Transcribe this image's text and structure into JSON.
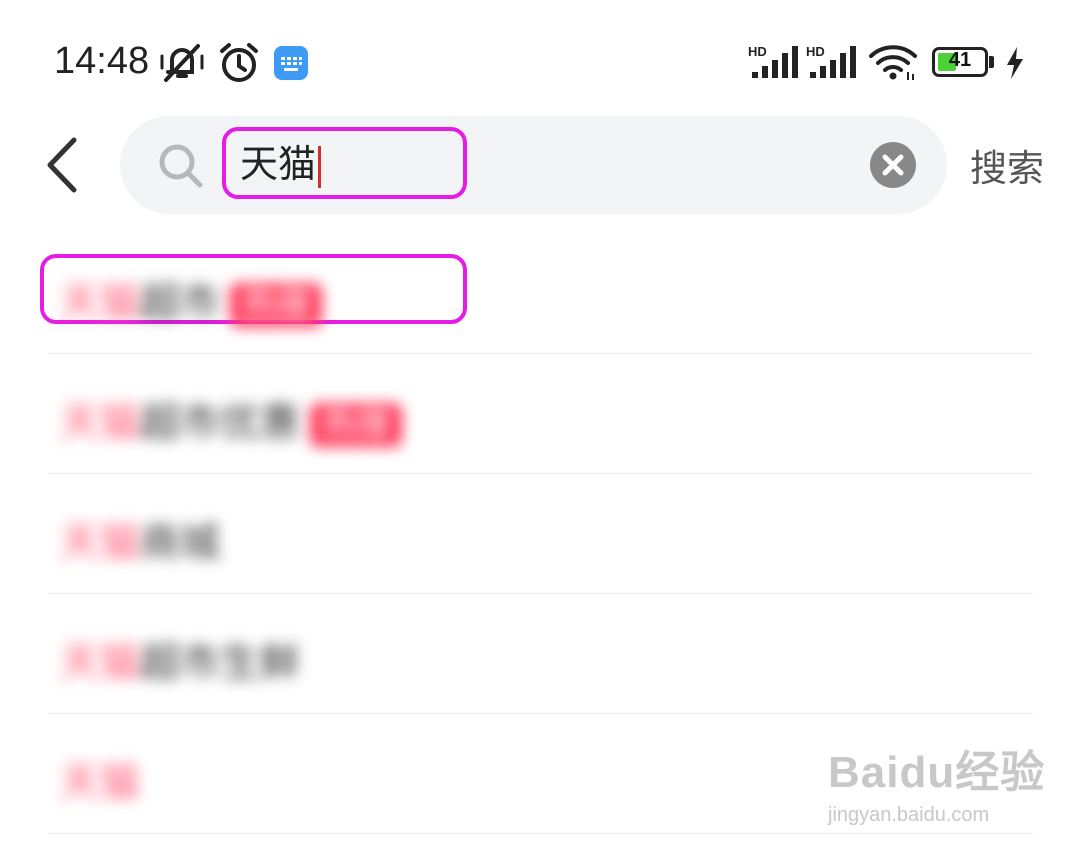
{
  "status_bar": {
    "time": "14:48",
    "icons": [
      "mute-vibrate-icon",
      "alarm-icon",
      "keyboard-app-icon",
      "signal-hd-1-icon",
      "signal-hd-2-icon",
      "wifi-icon",
      "charging-icon"
    ],
    "signal_labels": [
      "HD",
      "HD"
    ],
    "battery_level": "41",
    "battery_fraction": 0.41
  },
  "search": {
    "query": "天猫",
    "submit_label": "搜索"
  },
  "suggestions": [
    {
      "keyword": "天猫",
      "rest": "超市",
      "tag": "热搜"
    },
    {
      "keyword": "天猫",
      "rest": "超市优惠",
      "tag": "热搜"
    },
    {
      "keyword": "天猫",
      "rest": "商城",
      "tag": ""
    },
    {
      "keyword": "天猫",
      "rest": "超市生鲜",
      "tag": ""
    },
    {
      "keyword": "天猫",
      "rest": "",
      "tag": ""
    }
  ],
  "watermark": {
    "logo": "Baidu经验",
    "url": "jingyan.baidu.com"
  },
  "colors": {
    "annotation": "#e51ce5",
    "keyword": "#ff5c7a",
    "tag_bg": "#ff3b5c",
    "battery": "#4cd137"
  }
}
